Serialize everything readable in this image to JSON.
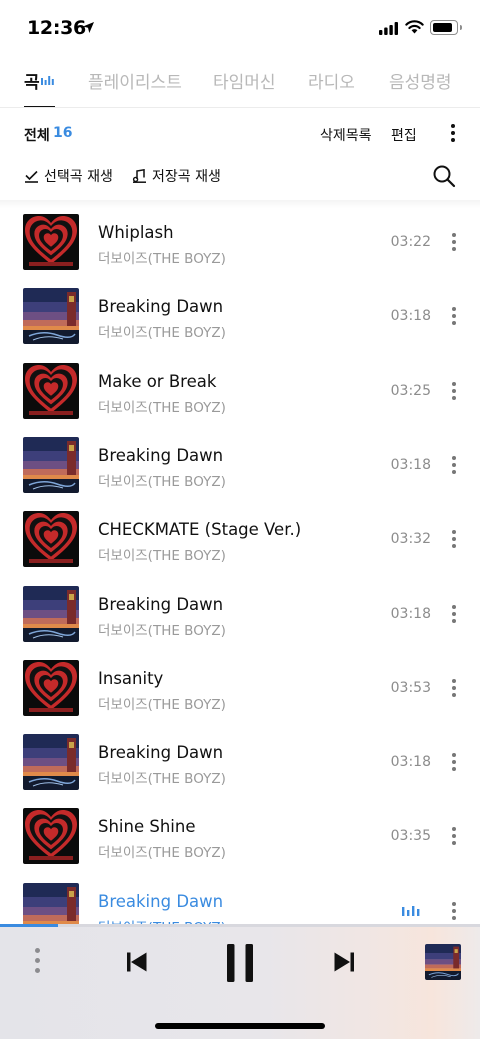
{
  "status_bar": {
    "time": "12:36"
  },
  "tabs": [
    {
      "label": "곡",
      "active": true
    },
    {
      "label": "플레이리스트",
      "active": false
    },
    {
      "label": "타임머신",
      "active": false
    },
    {
      "label": "라디오",
      "active": false
    },
    {
      "label": "음성명령",
      "active": false
    }
  ],
  "list_header": {
    "all_label": "전체",
    "count": "16",
    "deleted_list_label": "삭제목록",
    "edit_label": "편집"
  },
  "actions": {
    "play_selected_label": "선택곡 재생",
    "play_saved_label": "저장곡 재생"
  },
  "songs": [
    {
      "title": "Whiplash",
      "artist": "더보이즈(THE BOYZ)",
      "duration": "03:22",
      "art": "heart",
      "playing": false
    },
    {
      "title": "Breaking Dawn",
      "artist": "더보이즈(THE BOYZ)",
      "duration": "03:18",
      "art": "dawn",
      "playing": false
    },
    {
      "title": "Make or Break",
      "artist": "더보이즈(THE BOYZ)",
      "duration": "03:25",
      "art": "heart",
      "playing": false
    },
    {
      "title": "Breaking Dawn",
      "artist": "더보이즈(THE BOYZ)",
      "duration": "03:18",
      "art": "dawn",
      "playing": false
    },
    {
      "title": "CHECKMATE (Stage Ver.)",
      "artist": "더보이즈(THE BOYZ)",
      "duration": "03:32",
      "art": "heart",
      "playing": false
    },
    {
      "title": "Breaking Dawn",
      "artist": "더보이즈(THE BOYZ)",
      "duration": "03:18",
      "art": "dawn",
      "playing": false
    },
    {
      "title": "Insanity",
      "artist": "더보이즈(THE BOYZ)",
      "duration": "03:53",
      "art": "heart",
      "playing": false
    },
    {
      "title": "Breaking Dawn",
      "artist": "더보이즈(THE BOYZ)",
      "duration": "03:18",
      "art": "dawn",
      "playing": false
    },
    {
      "title": "Shine Shine",
      "artist": "더보이즈(THE BOYZ)",
      "duration": "03:35",
      "art": "heart",
      "playing": false
    },
    {
      "title": "Breaking Dawn",
      "artist": "더보이즈(THE BOYZ)",
      "duration": "",
      "art": "dawn",
      "playing": true
    }
  ],
  "player": {
    "progress": 0.12,
    "state": "playing"
  },
  "colors": {
    "accent": "#3a8be0",
    "text_primary": "#111111",
    "text_secondary": "#9a9a9a",
    "tab_inactive": "#b8b8b8"
  },
  "icons": {
    "location": "location-arrow-icon",
    "signal": "cellular-signal-icon",
    "wifi": "wifi-icon",
    "battery": "battery-icon",
    "equalizer": "equalizer-icon",
    "more": "more-vertical-icon",
    "check": "check-icon",
    "music_note": "music-note-icon",
    "search": "search-icon",
    "prev": "skip-previous-icon",
    "pause": "pause-icon",
    "next": "skip-next-icon"
  }
}
